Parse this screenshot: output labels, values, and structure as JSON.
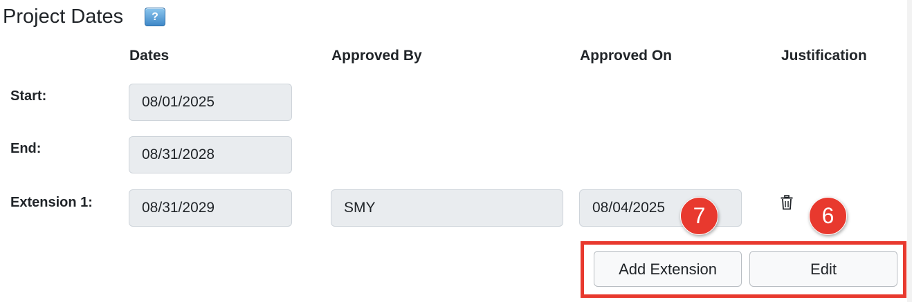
{
  "section": {
    "title": "Project Dates",
    "help_icon_glyph": "?"
  },
  "columns": {
    "dates": "Dates",
    "approved_by": "Approved By",
    "approved_on": "Approved On",
    "justification": "Justification"
  },
  "rows": [
    {
      "label": "Start:",
      "date": "08/01/2025"
    },
    {
      "label": "End:",
      "date": "08/31/2028"
    },
    {
      "label": "Extension 1:",
      "date": "08/31/2029",
      "approved_by": "SMY",
      "approved_on": "08/04/2025",
      "action_icon": "trash-icon"
    }
  ],
  "actions": {
    "add_extension_label": "Add Extension",
    "edit_label": "Edit"
  },
  "annotations": {
    "marker_add_extension": "7",
    "marker_edit": "6",
    "highlight_color": "#e8392e"
  },
  "colors": {
    "field_background": "#e9ecef",
    "help_icon": "#3f88c8"
  }
}
